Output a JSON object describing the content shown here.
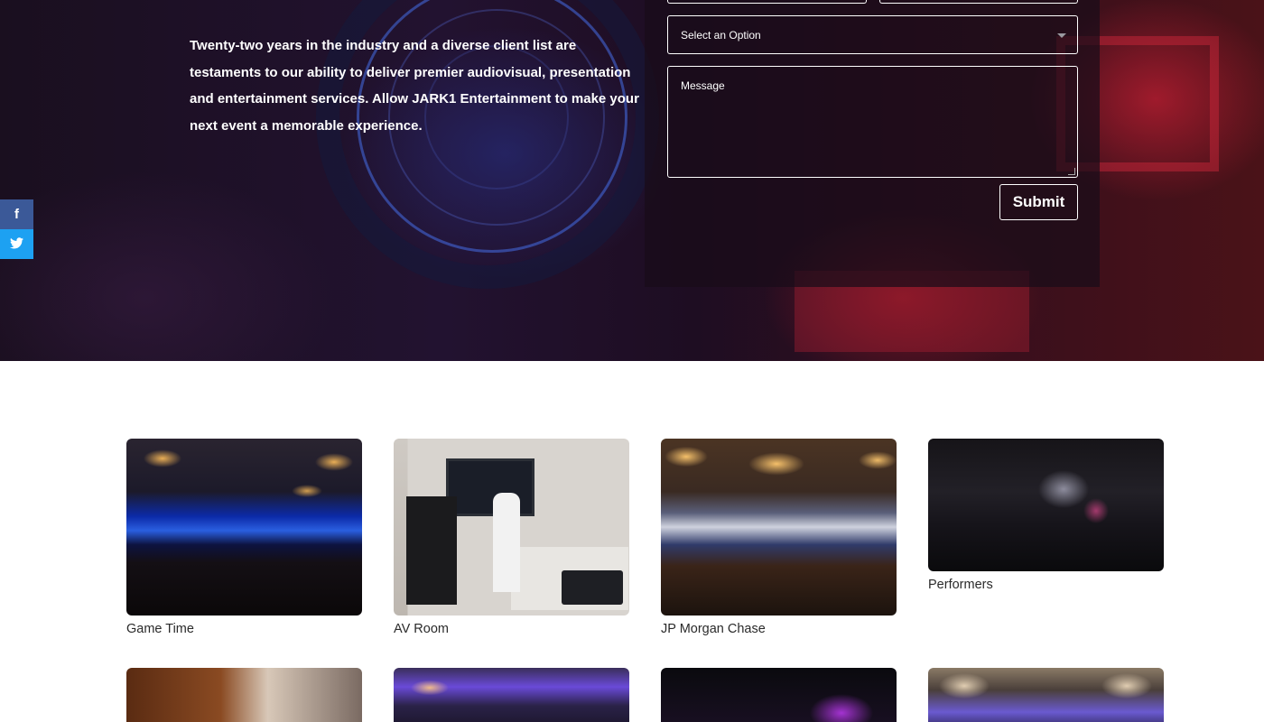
{
  "hero": {
    "intro_before": "Twenty-two years in the industry and a diverse client list are testaments to our ability to deliver premier audiovisual, presentation and entertainment services. Allow ",
    "company_name": "JARK1 Entertainment",
    "intro_after": " to make your next event a memorable experience."
  },
  "form": {
    "select_value": "Select an Option",
    "message_placeholder": "Message",
    "submit_label": "Submit"
  },
  "share": {
    "facebook_glyph": "f"
  },
  "gallery": {
    "items": [
      {
        "caption": "Game Time"
      },
      {
        "caption": "AV Room"
      },
      {
        "caption": "JP Morgan Chase"
      },
      {
        "caption": "Performers"
      }
    ]
  },
  "icons": [
    "facebook-icon",
    "twitter-icon",
    "chevron-down-icon"
  ],
  "colors": {
    "facebook": "#3b5998",
    "twitter": "#1da1f2",
    "caption_text": "#2a2a2a"
  }
}
